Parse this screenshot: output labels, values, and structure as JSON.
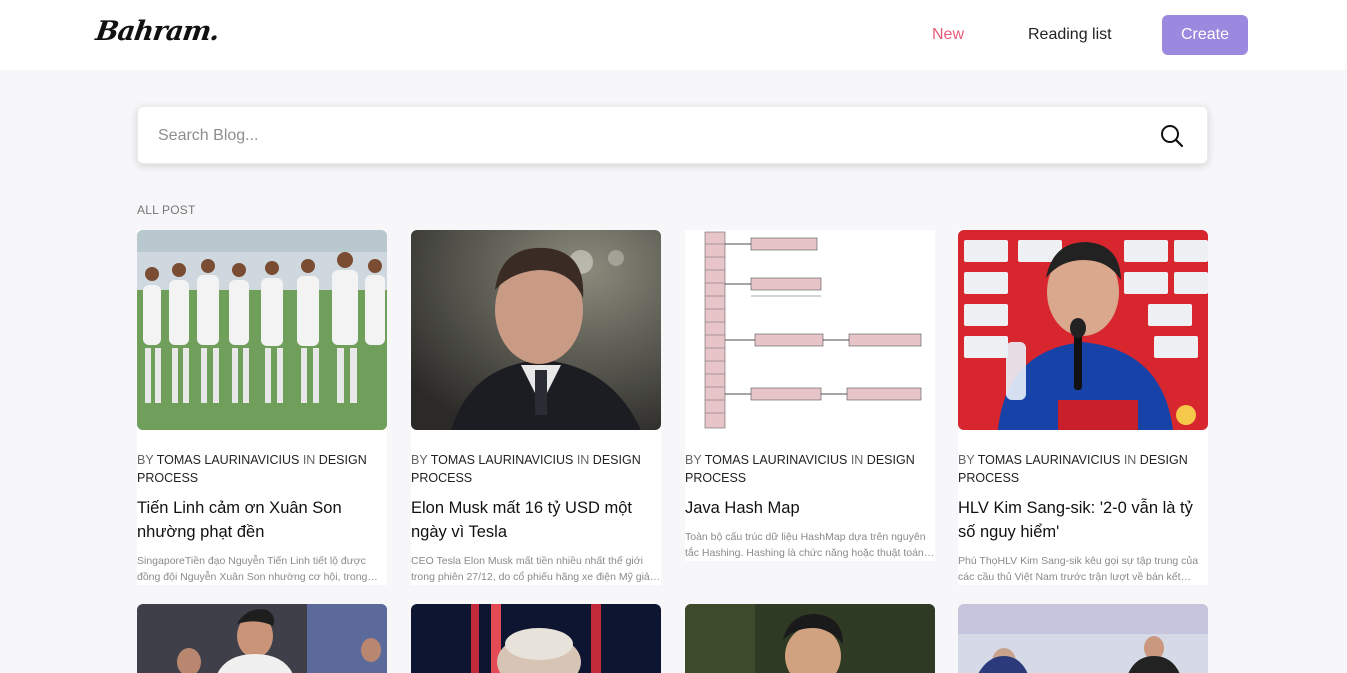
{
  "header": {
    "logo": "Bahram.",
    "nav": {
      "new": "New",
      "reading_list": "Reading list",
      "create": "Create"
    }
  },
  "search": {
    "placeholder": "Search Blog..."
  },
  "section_label": "ALL POST",
  "posts": [
    {
      "by": "BY",
      "author": "TOMAS LAURINAVICIUS",
      "in": "IN",
      "category": "DESIGN PROCESS",
      "title": "Tiến Linh cảm ơn Xuân Son nhường phạt đền",
      "excerpt": "SingaporeTiền đạo Nguyễn Tiến Linh tiết lộ được đồng đội Nguyễn Xuân Son nhường cơ hội, trong trận thắng..."
    },
    {
      "by": "BY",
      "author": "TOMAS LAURINAVICIUS",
      "in": "IN",
      "category": "DESIGN PROCESS",
      "title": "Elon Musk mất 16 tỷ USD một ngày vì Tesla",
      "excerpt": "CEO Tesla Elon Musk mất tiền nhiều nhất thế giới trong phiên 27/12, do cổ phiếu hãng xe điện Mỹ giảm mạnh...."
    },
    {
      "by": "BY",
      "author": "TOMAS LAURINAVICIUS",
      "in": "IN",
      "category": "DESIGN PROCESS",
      "title": "Java Hash Map",
      "excerpt": "Toàn bộ cấu trúc dữ liệu HashMap dựa trên nguyên tắc Hashing. Hashing là chức năng hoặc thuật toán hoặc..."
    },
    {
      "by": "BY",
      "author": "TOMAS LAURINAVICIUS",
      "in": "IN",
      "category": "DESIGN PROCESS",
      "title": "HLV Kim Sang-sik: '2-0 vẫn là tỷ số nguy hiểm'",
      "excerpt": "Phú ThọHLV Kim Sang-sik kêu gọi sự tập trung của các cầu thủ Việt Nam trước trận lượt về bán kết ASEAN Cu..."
    }
  ],
  "colors": {
    "accent": "#9b89df",
    "nav_active": "#e75b7a"
  }
}
